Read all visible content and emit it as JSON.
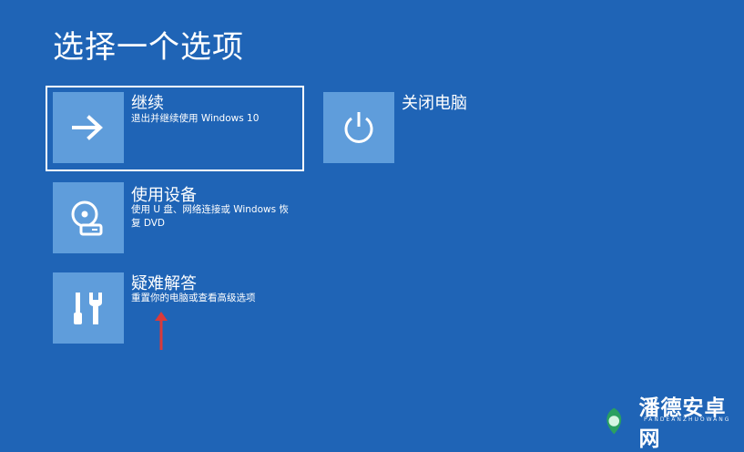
{
  "title": "选择一个选项",
  "options": [
    {
      "title": "继续",
      "desc": "退出并继续使用 Windows 10",
      "icon": "arrow-right-icon"
    },
    {
      "title": "关闭电脑",
      "desc": "",
      "icon": "power-icon"
    },
    {
      "title": "使用设备",
      "desc": "使用 U 盘、网络连接或 Windows 恢复 DVD",
      "icon": "disc-drive-icon"
    },
    {
      "title": "疑难解答",
      "desc": "重置你的电脑或查看高级选项",
      "icon": "tools-icon"
    }
  ],
  "watermark": {
    "text": "潘德安卓网",
    "sub": "PANDEANZHUOWANG"
  },
  "colors": {
    "background": "#1f64b6",
    "tile": "#5f9ddb",
    "annotation_arrow": "#d93a3a"
  }
}
